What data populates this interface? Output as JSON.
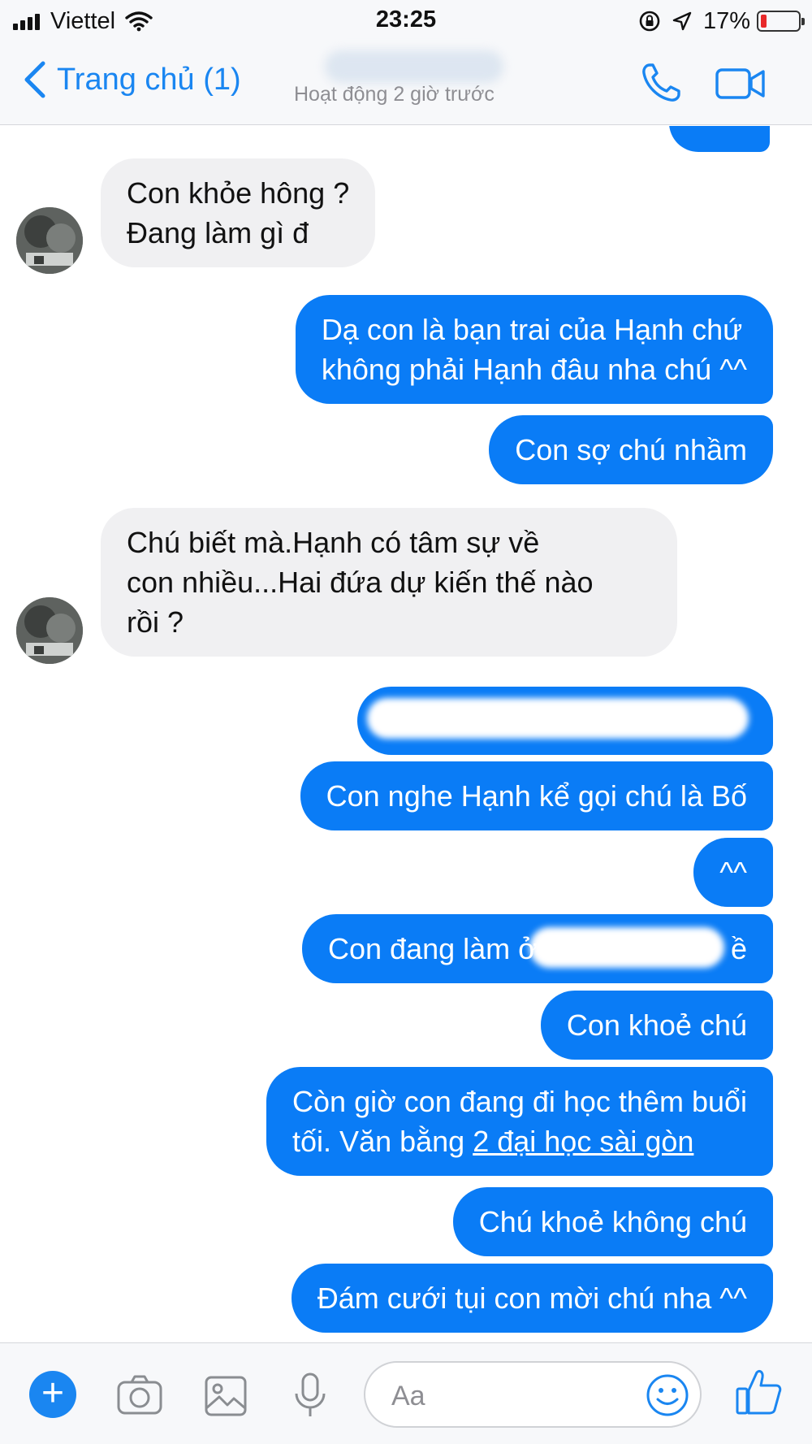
{
  "status_bar": {
    "carrier": "Viettel",
    "time": "23:25",
    "battery_percent": "17%",
    "battery_level": 0.17,
    "battery_color": "#e8292a"
  },
  "header": {
    "back_label": "Trang chủ (1)",
    "active_status": "Hoạt động 2 giờ trước",
    "icons": [
      "chevron-left-icon",
      "phone-icon",
      "video-camera-icon"
    ],
    "accent_color": "#1a86f1"
  },
  "messages": [
    {
      "sender": "other",
      "lines": [
        "Con khỏe hông ?",
        "Đang làm gì đ"
      ]
    },
    {
      "sender": "me",
      "lines": [
        "Dạ con là bạn trai của Hạnh chứ",
        "không phải Hạnh đâu nha chú ^^"
      ]
    },
    {
      "sender": "me",
      "lines": [
        "Con sợ chú nhầm"
      ]
    },
    {
      "sender": "other",
      "lines": [
        "Chú biết mà.Hạnh có tâm sự về",
        "con nhiều...Hai đứa dự kiến thế nào",
        "rồi ?"
      ]
    },
    {
      "sender": "me",
      "lines": [
        ""
      ],
      "redacted": true
    },
    {
      "sender": "me",
      "lines": [
        "Con nghe Hạnh kể gọi chú là Bố"
      ]
    },
    {
      "sender": "me",
      "lines": [
        "^^"
      ]
    },
    {
      "sender": "me",
      "lines": [
        "Con đang làm ở",
        "ề"
      ],
      "partially_redacted": true
    },
    {
      "sender": "me",
      "lines": [
        "Con khoẻ chú"
      ]
    },
    {
      "sender": "me",
      "lines": [
        "Còn giờ con đang đi học thêm buổi",
        "tối. Văn bằng "
      ],
      "link_text": "2 đại học sài gòn"
    },
    {
      "sender": "me",
      "lines": [
        "Chú khoẻ không chú"
      ]
    },
    {
      "sender": "me",
      "lines": [
        "Đám cưới tụi con mời chú nha ^^"
      ]
    }
  ],
  "composer": {
    "placeholder": "Aa",
    "icons": [
      "plus-icon",
      "camera-icon",
      "image-icon",
      "microphone-icon",
      "emoji-icon",
      "thumbs-up-icon"
    ]
  },
  "colors": {
    "outgoing_bubble": "#0a7cf6",
    "incoming_bubble": "#f0f0f2"
  }
}
